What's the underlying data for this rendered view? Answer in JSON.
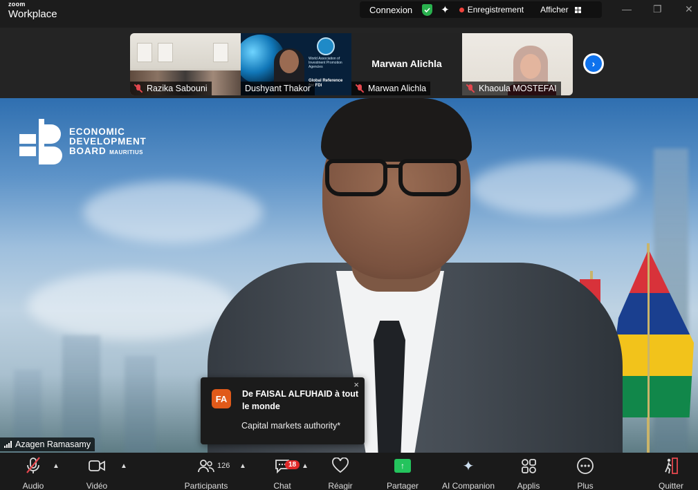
{
  "app": {
    "logo_small": "zoom",
    "logo_big": "Workplace"
  },
  "titlebar": {
    "connexion": "Connexion",
    "recording": "Enregistrement",
    "view": "Afficher",
    "window_controls": [
      "—",
      "❐",
      "✕"
    ]
  },
  "strip": {
    "thumbnails": [
      {
        "name": "Razika Sabouni",
        "muted": true
      },
      {
        "name": "Dushyant Thakor",
        "muted": false,
        "slide_text": [
          "World Association of Investment Promotion Agencies",
          "Global Reference for FDI"
        ]
      },
      {
        "name": "Marwan Alichla",
        "big_name": "Marwan Alichla",
        "muted": true
      },
      {
        "name": "Khaoula MOSTEFAI",
        "muted": true
      }
    ],
    "next_icon": "chevron-right-icon"
  },
  "video": {
    "logo_lines": [
      "ECONOMIC",
      "DEVELOPMENT",
      "BOARD"
    ],
    "logo_suffix": "MAURITIUS",
    "speaker_name": "Azagen Ramasamy"
  },
  "chat_toast": {
    "avatar_initials": "FA",
    "from": "De FAISAL ALFUHAID à tout le monde",
    "message": "Capital markets authority*",
    "close": "×"
  },
  "toolbar": {
    "audio": "Audio",
    "video": "Vidéo",
    "participants": "Participants",
    "participants_count": "126",
    "chat": "Chat",
    "chat_badge": "18",
    "react": "Réagir",
    "share": "Partager",
    "companion": "AI Companion",
    "apps": "Applis",
    "more": "Plus",
    "quit": "Quitter"
  },
  "colors": {
    "accent_blue": "#0e72ed",
    "share_green": "#24c45d",
    "record_red": "#f0433c",
    "badge_red": "#e02828",
    "avatar_orange": "#e05a1a"
  }
}
